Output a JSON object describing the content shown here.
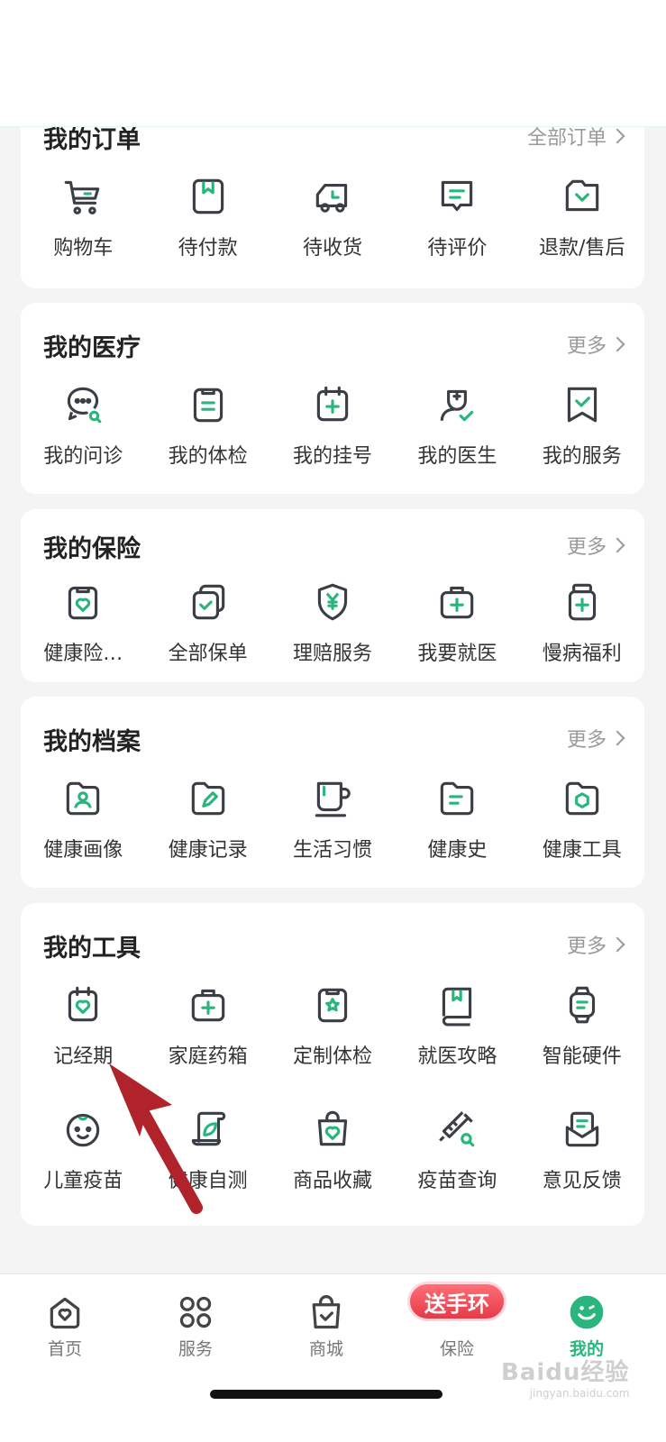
{
  "orders": {
    "title": "我的订单",
    "more": "全部订单",
    "items": [
      {
        "label": "购物车",
        "icon": "cart-icon"
      },
      {
        "label": "待付款",
        "icon": "wallet-icon"
      },
      {
        "label": "待收货",
        "icon": "truck-icon"
      },
      {
        "label": "待评价",
        "icon": "comment-icon"
      },
      {
        "label": "退款/售后",
        "icon": "refund-icon"
      }
    ]
  },
  "medical": {
    "title": "我的医疗",
    "more": "更多",
    "items": [
      {
        "label": "我的问诊",
        "icon": "chat-consult-icon"
      },
      {
        "label": "我的体检",
        "icon": "clipboard-icon"
      },
      {
        "label": "我的挂号",
        "icon": "calendar-plus-icon"
      },
      {
        "label": "我的医生",
        "icon": "doctor-icon"
      },
      {
        "label": "我的服务",
        "icon": "bookmark-check-icon"
      }
    ]
  },
  "insurance": {
    "title": "我的保险",
    "more": "更多",
    "items": [
      {
        "label": "健康险…",
        "icon": "heart-clipboard-icon"
      },
      {
        "label": "全部保单",
        "icon": "policy-stack-icon"
      },
      {
        "label": "理赔服务",
        "icon": "shield-yen-icon"
      },
      {
        "label": "我要就医",
        "icon": "medkit-icon"
      },
      {
        "label": "慢病福利",
        "icon": "medicine-bottle-icon"
      }
    ]
  },
  "archive": {
    "title": "我的档案",
    "more": "更多",
    "items": [
      {
        "label": "健康画像",
        "icon": "folder-person-icon"
      },
      {
        "label": "健康记录",
        "icon": "folder-pen-icon"
      },
      {
        "label": "生活习惯",
        "icon": "cup-icon"
      },
      {
        "label": "健康史",
        "icon": "folder-lines-icon"
      },
      {
        "label": "健康工具",
        "icon": "folder-hexagon-icon"
      }
    ]
  },
  "tools": {
    "title": "我的工具",
    "more": "更多",
    "row1": [
      {
        "label": "记经期",
        "icon": "period-calendar-icon"
      },
      {
        "label": "家庭药箱",
        "icon": "medicine-box-icon"
      },
      {
        "label": "定制体检",
        "icon": "star-clipboard-icon"
      },
      {
        "label": "就医攻略",
        "icon": "book-icon"
      },
      {
        "label": "智能硬件",
        "icon": "smartwatch-icon"
      }
    ],
    "row2": [
      {
        "label": "儿童疫苗",
        "icon": "baby-face-icon"
      },
      {
        "label": "健康自测",
        "icon": "scroll-leaf-icon"
      },
      {
        "label": "商品收藏",
        "icon": "bag-heart-icon"
      },
      {
        "label": "疫苗查询",
        "icon": "syringe-search-icon"
      },
      {
        "label": "意见反馈",
        "icon": "feedback-icon"
      }
    ]
  },
  "tabbar": {
    "tabs": [
      {
        "label": "首页",
        "icon": "home-heart-icon"
      },
      {
        "label": "服务",
        "icon": "grid-circles-icon"
      },
      {
        "label": "商城",
        "icon": "shopping-bag-icon"
      },
      {
        "label": "保险",
        "icon": "insurance-icon"
      },
      {
        "label": "我的",
        "icon": "smile-icon"
      }
    ],
    "promo": "送手环",
    "active_color": "#2ab57d"
  },
  "watermark": {
    "brand": "Baidu经验",
    "url": "jingyan.baidu.com"
  },
  "colors": {
    "icon_dark": "#3b3f45",
    "icon_green": "#2ab57d",
    "arrow": "#b0232a"
  }
}
